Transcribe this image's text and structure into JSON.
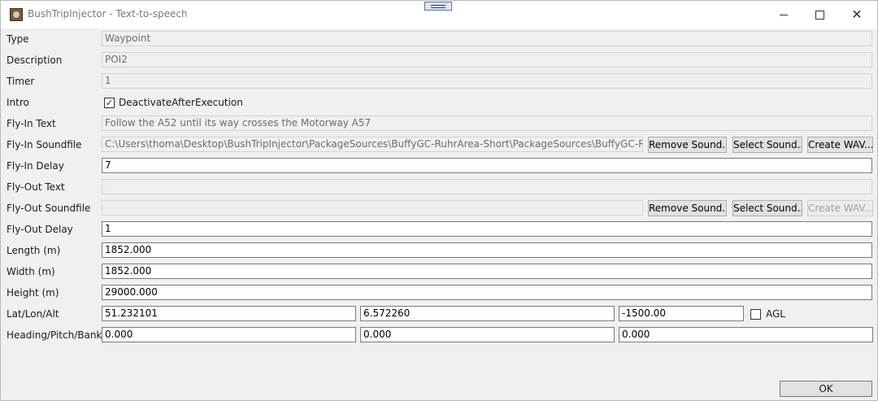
{
  "window": {
    "title": "BushTripInjector - Text-to-speech",
    "minimize_glyph": "",
    "close_glyph": "✕"
  },
  "form": {
    "type": {
      "label": "Type",
      "value": "Waypoint"
    },
    "description": {
      "label": "Description",
      "value": "POI2"
    },
    "timer": {
      "label": "Timer",
      "value": "1"
    },
    "intro": {
      "label": "Intro",
      "checkbox_label": "DeactivateAfterExecution",
      "checked": true,
      "check_glyph": "✓"
    },
    "fly_in_text": {
      "label": "Fly-In Text",
      "value": "Follow the A52 until its way crosses the Motorway A57"
    },
    "fly_in_soundfile": {
      "label": "Fly-In Soundfile",
      "value": "C:\\Users\\thoma\\Desktop\\BushTripInjector\\PackageSources\\BuffyGC-RuhrArea-Short\\PackageSources\\BuffyGC-RuhrArea-Short",
      "remove_label": "Remove Sound...",
      "select_label": "Select Sound...",
      "create_label": "Create WAV..."
    },
    "fly_in_delay": {
      "label": "Fly-In Delay",
      "value": "7"
    },
    "fly_out_text": {
      "label": "Fly-Out Text",
      "value": ""
    },
    "fly_out_soundfile": {
      "label": "Fly-Out Soundfile",
      "value": "",
      "remove_label": "Remove Sound...",
      "select_label": "Select Sound...",
      "create_label": "Create WAV..."
    },
    "fly_out_delay": {
      "label": "Fly-Out Delay",
      "value": "1"
    },
    "length": {
      "label": "Length (m)",
      "value": "1852.000"
    },
    "width": {
      "label": "Width (m)",
      "value": "1852.000"
    },
    "height": {
      "label": "Height (m)",
      "value": "29000.000"
    },
    "lat_lon_alt": {
      "label": "Lat/Lon/Alt",
      "lat": "51.232101",
      "lon": "6.572260",
      "alt": "-1500.00",
      "agl_label": "AGL",
      "agl_checked": false
    },
    "heading_pitch_bank": {
      "label": "Heading/Pitch/Bank",
      "heading": "0.000",
      "pitch": "0.000",
      "bank": "0.000"
    }
  },
  "ok_label": "OK"
}
